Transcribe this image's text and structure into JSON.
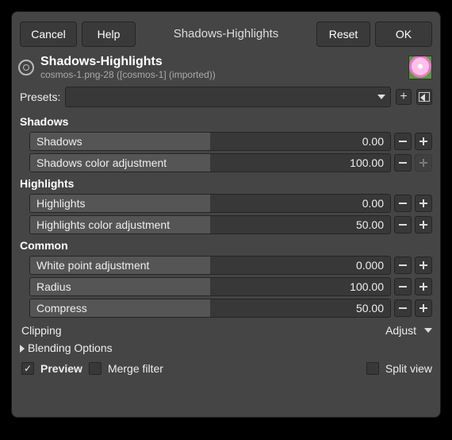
{
  "buttons": {
    "cancel": "Cancel",
    "help": "Help",
    "title": "Shadows-Highlights",
    "reset": "Reset",
    "ok": "OK"
  },
  "header": {
    "title": "Shadows-Highlights",
    "subtitle": "cosmos-1.png-28 ([cosmos-1] (imported))"
  },
  "presets": {
    "label": "Presets:"
  },
  "sections": {
    "shadows": "Shadows",
    "highlights": "Highlights",
    "common": "Common"
  },
  "sliders": {
    "shadows": {
      "label": "Shadows",
      "value": "0.00",
      "fill": 50
    },
    "shadows_color": {
      "label": "Shadows color adjustment",
      "value": "100.00",
      "fill": 50
    },
    "highlights": {
      "label": "Highlights",
      "value": "0.00",
      "fill": 50
    },
    "highlights_color": {
      "label": "Highlights color adjustment",
      "value": "50.00",
      "fill": 50
    },
    "white_point": {
      "label": "White point adjustment",
      "value": "0.000",
      "fill": 50
    },
    "radius": {
      "label": "Radius",
      "value": "100.00",
      "fill": 50
    },
    "compress": {
      "label": "Compress",
      "value": "50.00",
      "fill": 50
    }
  },
  "clipping": {
    "label": "Clipping",
    "value": "Adjust"
  },
  "blending": {
    "label": "Blending Options"
  },
  "footer": {
    "preview": "Preview",
    "merge": "Merge filter",
    "split": "Split view"
  }
}
